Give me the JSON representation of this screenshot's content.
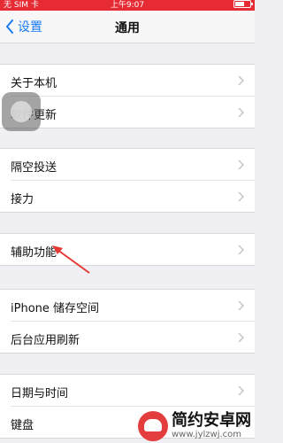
{
  "status_bar": {
    "carrier": "无 SIM 卡",
    "time": "上午9:07",
    "battery_level": 0.6,
    "color": "#e62b35"
  },
  "nav": {
    "back_label": "设置",
    "title": "通用",
    "accent_color": "#1a7bf3"
  },
  "groups": [
    {
      "items": [
        "关于本机",
        "软件更新"
      ]
    },
    {
      "items": [
        "隔空投送",
        "接力"
      ]
    },
    {
      "items": [
        "辅助功能"
      ]
    },
    {
      "items": [
        "iPhone 储存空间",
        "后台应用刷新"
      ]
    },
    {
      "items": [
        "日期与时间",
        "键盘"
      ]
    }
  ],
  "watermark": {
    "title": "简约安卓网",
    "url": "www.jylzwj.com"
  },
  "annotation": {
    "arrow_color": "#e53935"
  }
}
